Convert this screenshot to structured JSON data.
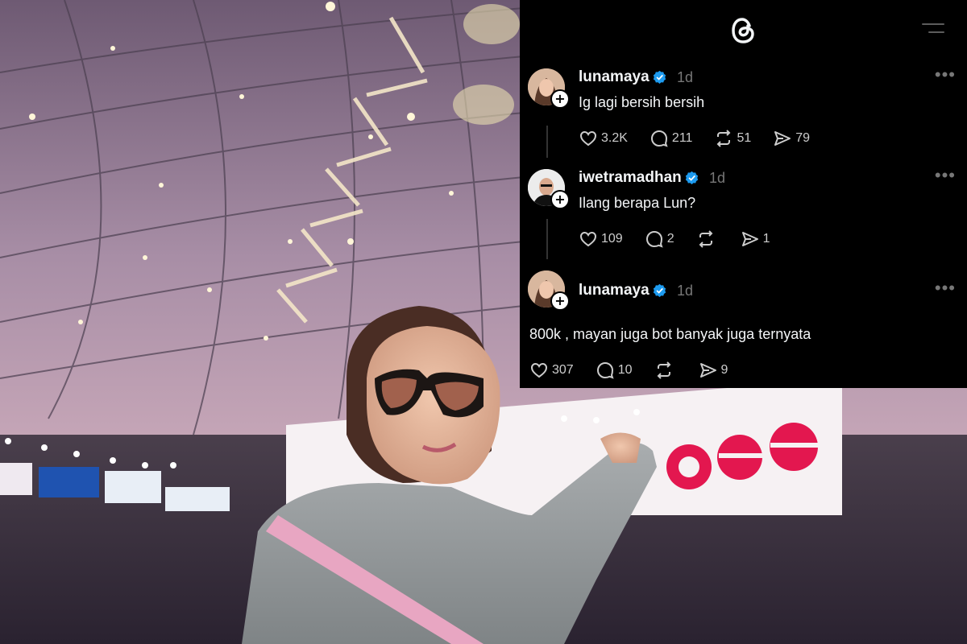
{
  "app": {
    "logo_icon": "threads-logo-icon",
    "menu_icon": "hamburger-menu-icon"
  },
  "posts": [
    {
      "username": "lunamaya",
      "time": "1d",
      "text": "Ig lagi bersih bersih",
      "stats": {
        "likes": "3.2K",
        "replies": "211",
        "reposts": "51",
        "shares": "79"
      }
    },
    {
      "username": "iwetramadhan",
      "time": "1d",
      "text": "Ilang berapa Lun?",
      "stats": {
        "likes": "109",
        "replies": "2",
        "reposts": "",
        "shares": "1"
      }
    },
    {
      "username": "lunamaya",
      "time": "1d",
      "text": "800k , mayan juga bot banyak juga ternyata",
      "stats": {
        "likes": "307",
        "replies": "10",
        "reposts": "",
        "shares": "9"
      }
    }
  ],
  "colors": {
    "verified": "#1d9bf0",
    "panel_bg": "#000000",
    "screen_logo": "#e3174f"
  }
}
